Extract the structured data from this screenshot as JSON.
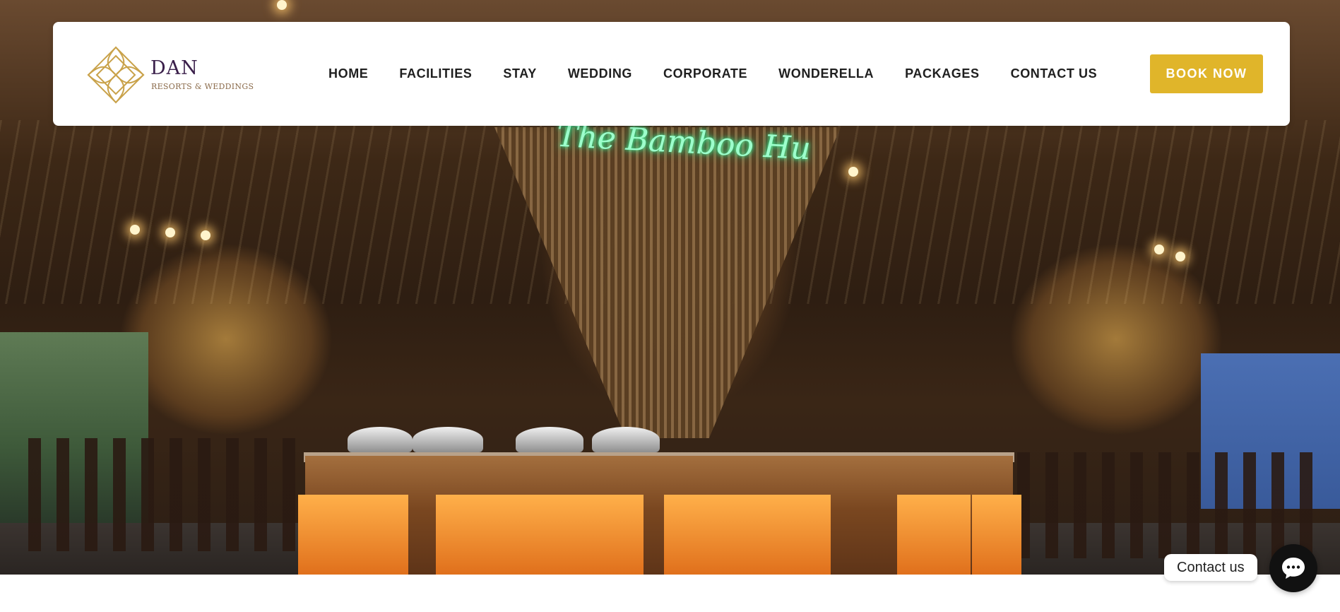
{
  "brand": {
    "name": "DAN",
    "tagline": "RESORTS & WEDDINGS",
    "logo_icon": "lotus-diamond-logo",
    "colors": {
      "gold": "#c9a24a",
      "purple": "#3a1f4a"
    }
  },
  "nav": {
    "items": [
      {
        "label": "HOME"
      },
      {
        "label": "FACILITIES"
      },
      {
        "label": "STAY"
      },
      {
        "label": "WEDDING"
      },
      {
        "label": "CORPORATE"
      },
      {
        "label": "WONDERELLA"
      },
      {
        "label": "PACKAGES"
      },
      {
        "label": "CONTACT US"
      }
    ]
  },
  "cta": {
    "book_label": "BOOK NOW",
    "color": "#e0b52a"
  },
  "hero": {
    "neon_sign": "The Bamboo Hu"
  },
  "chat": {
    "label": "Contact us",
    "icon": "chat-bubble-icon"
  }
}
